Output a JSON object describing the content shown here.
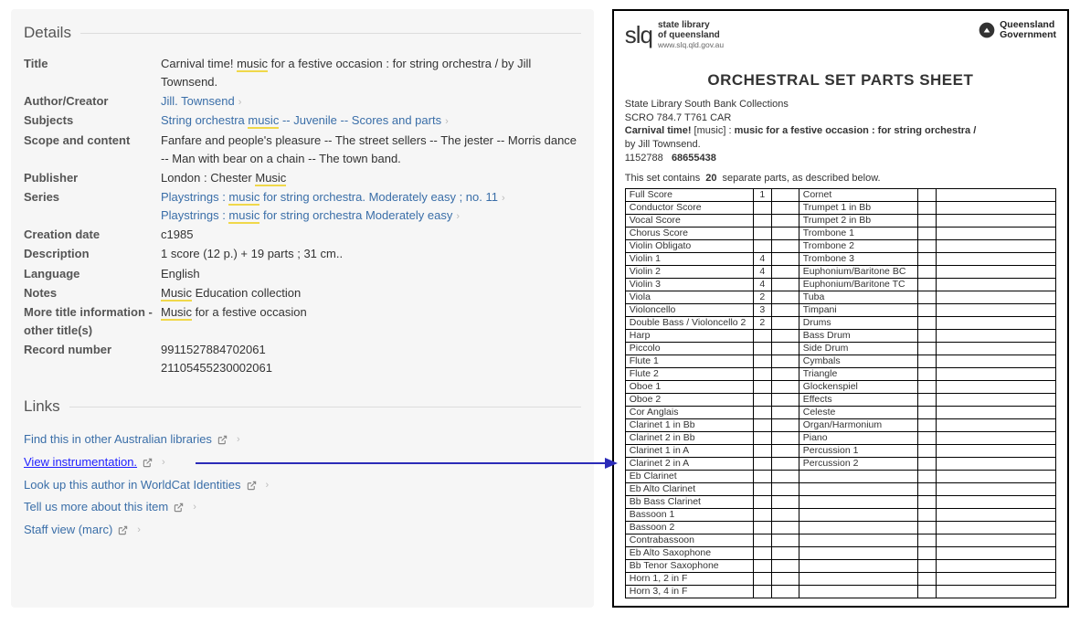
{
  "left": {
    "details_heading": "Details",
    "rows": {
      "title_label": "Title",
      "title_pre": "Carnival time! ",
      "title_hl": "music",
      "title_post": " for a festive occasion : for string orchestra / by Jill Townsend.",
      "author_label": "Author/Creator",
      "author_val": "Jill. Townsend",
      "subjects_label": "Subjects",
      "subjects_pre": "String orchestra ",
      "subjects_hl": "music",
      "subjects_post": " -- Juvenile -- Scores and parts",
      "scope_label": "Scope and content",
      "scope_val": "Fanfare and people's pleasure -- The street sellers -- The jester -- Morris dance -- Man with bear on a chain -- The town band.",
      "publisher_label": "Publisher",
      "publisher_pre": "London : Chester ",
      "publisher_hl": "Music",
      "series_label": "Series",
      "series1_pre": "Playstrings : ",
      "series1_hl": "music",
      "series1_post": " for string orchestra. Moderately easy ; no. 11",
      "series2_pre": "Playstrings : ",
      "series2_hl": "music",
      "series2_post": " for string orchestra Moderately easy",
      "creation_label": "Creation date",
      "creation_val": "c1985",
      "desc_label": "Description",
      "desc_val": "1 score (12 p.) + 19 parts ; 31 cm..",
      "lang_label": "Language",
      "lang_val": "English",
      "notes_label": "Notes",
      "notes_hl": "Music",
      "notes_post": " Education collection",
      "more_label": "More title information - other title(s)",
      "more_hl": "Music",
      "more_post": " for a festive occasion",
      "recno_label": "Record number",
      "recno_1": "9911527884702061",
      "recno_2": "21105455230002061"
    },
    "links_heading": "Links",
    "links": {
      "l1": "Find this in other Australian libraries",
      "l2": "View instrumentation.",
      "l3": "Look up this author in WorldCat Identities",
      "l4": "Tell us more about this item",
      "l5": "Staff view (marc)"
    }
  },
  "right": {
    "slq_mark": "slq",
    "slq_line1": "state library",
    "slq_line2": "of queensland",
    "slq_url": "www.slq.qld.gov.au",
    "qg_line1": "Queensland",
    "qg_line2": "Government",
    "title": "ORCHESTRAL SET PARTS SHEET",
    "meta": {
      "l1": "State Library South Bank Collections",
      "l2": "SCRO 784.7 T761 CAR",
      "l3a": "Carnival time!",
      "l3b": " [music] : ",
      "l3c": "music for a festive occasion : for string orchestra /",
      "l4": "by Jill Townsend.",
      "l5a": "1152788",
      "l5b": "68655438"
    },
    "contains_pre": "This set contains",
    "contains_n": "20",
    "contains_post": "separate parts, as described below.",
    "chart_data": {
      "type": "table",
      "columns": [
        "left_part",
        "left_qty",
        "right_part",
        "right_qty"
      ],
      "rows": [
        {
          "l": "Full Score",
          "lq": "1",
          "r": "Cornet",
          "rq": ""
        },
        {
          "l": "Conductor Score",
          "lq": "",
          "r": "Trumpet 1 in Bb",
          "rq": ""
        },
        {
          "l": "Vocal Score",
          "lq": "",
          "r": "Trumpet 2 in Bb",
          "rq": ""
        },
        {
          "l": "Chorus Score",
          "lq": "",
          "r": "Trombone 1",
          "rq": ""
        },
        {
          "l": "Violin Obligato",
          "lq": "",
          "r": "Trombone 2",
          "rq": ""
        },
        {
          "l": "Violin 1",
          "lq": "4",
          "r": "Trombone 3",
          "rq": ""
        },
        {
          "l": "Violin 2",
          "lq": "4",
          "r": "Euphonium/Baritone BC",
          "rq": ""
        },
        {
          "l": "Violin 3",
          "lq": "4",
          "r": "Euphonium/Baritone TC",
          "rq": ""
        },
        {
          "l": "Viola",
          "lq": "2",
          "r": "Tuba",
          "rq": ""
        },
        {
          "l": "Violoncello",
          "lq": "3",
          "r": "Timpani",
          "rq": ""
        },
        {
          "l": "Double Bass / Violoncello 2",
          "lq": "2",
          "r": "Drums",
          "rq": ""
        },
        {
          "l": "Harp",
          "lq": "",
          "r": "Bass Drum",
          "rq": ""
        },
        {
          "l": "Piccolo",
          "lq": "",
          "r": "Side Drum",
          "rq": ""
        },
        {
          "l": "Flute 1",
          "lq": "",
          "r": "Cymbals",
          "rq": ""
        },
        {
          "l": "Flute 2",
          "lq": "",
          "r": "Triangle",
          "rq": ""
        },
        {
          "l": "Oboe 1",
          "lq": "",
          "r": "Glockenspiel",
          "rq": ""
        },
        {
          "l": "Oboe 2",
          "lq": "",
          "r": "Effects",
          "rq": ""
        },
        {
          "l": "Cor Anglais",
          "lq": "",
          "r": "Celeste",
          "rq": ""
        },
        {
          "l": "Clarinet 1 in Bb",
          "lq": "",
          "r": "Organ/Harmonium",
          "rq": ""
        },
        {
          "l": "Clarinet 2 in Bb",
          "lq": "",
          "r": "Piano",
          "rq": ""
        },
        {
          "l": "Clarinet 1 in A",
          "lq": "",
          "r": "Percussion 1",
          "rq": ""
        },
        {
          "l": "Clarinet 2 in A",
          "lq": "",
          "r": "Percussion 2",
          "rq": ""
        },
        {
          "l": "Eb Clarinet",
          "lq": "",
          "r": "",
          "rq": ""
        },
        {
          "l": "Eb Alto Clarinet",
          "lq": "",
          "r": "",
          "rq": ""
        },
        {
          "l": "Bb Bass Clarinet",
          "lq": "",
          "r": "",
          "rq": ""
        },
        {
          "l": "Bassoon 1",
          "lq": "",
          "r": "",
          "rq": ""
        },
        {
          "l": "Bassoon 2",
          "lq": "",
          "r": "",
          "rq": ""
        },
        {
          "l": "Contrabassoon",
          "lq": "",
          "r": "",
          "rq": ""
        },
        {
          "l": "Eb Alto Saxophone",
          "lq": "",
          "r": "",
          "rq": ""
        },
        {
          "l": "Bb Tenor Saxophone",
          "lq": "",
          "r": "",
          "rq": ""
        },
        {
          "l": "Horn 1, 2 in F",
          "lq": "",
          "r": "",
          "rq": ""
        },
        {
          "l": "Horn 3, 4 in F",
          "lq": "",
          "r": "",
          "rq": ""
        }
      ]
    }
  }
}
